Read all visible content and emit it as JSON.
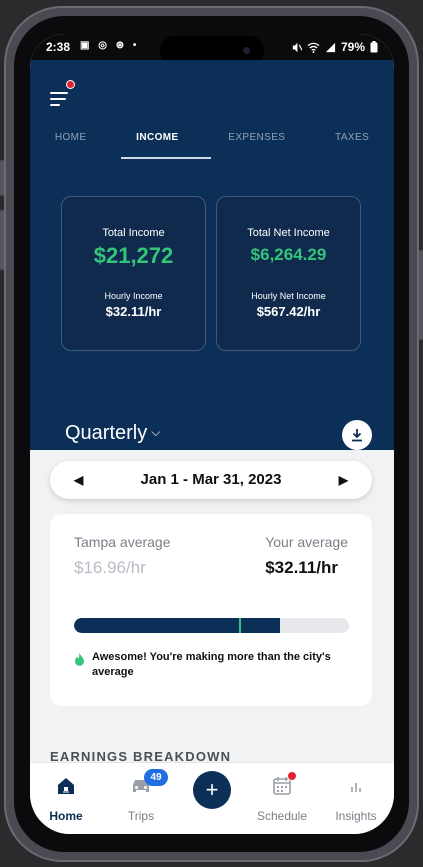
{
  "status_bar": {
    "time": "2:38",
    "battery": "79%"
  },
  "tabs": [
    {
      "label": "HOME"
    },
    {
      "label": "INCOME"
    },
    {
      "label": "EXPENSES"
    },
    {
      "label": "TAXES"
    }
  ],
  "cards": {
    "total_income": {
      "label": "Total Income",
      "value": "$21,272",
      "sub_label": "Hourly Income",
      "sub_value": "$32.11/hr"
    },
    "total_net": {
      "label": "Total Net Income",
      "value": "$6,264.29",
      "sub_label": "Hourly Net Income",
      "sub_value": "$567.42/hr"
    }
  },
  "period": {
    "label": "Quarterly"
  },
  "date_range": {
    "label": "Jan 1 - Mar 31, 2023"
  },
  "average": {
    "city_label": "Tampa average",
    "city_value": "$16.96/hr",
    "your_label": "Your average",
    "your_value": "$32.11/hr",
    "progress_fraction": 0.75,
    "city_marker_fraction": 0.6,
    "message": "Awesome! You're making more than the city's average"
  },
  "section": {
    "title": "EARNINGS BREAKDOWN"
  },
  "bottom_nav": {
    "home": "Home",
    "trips": "Trips",
    "trips_badge": "49",
    "add": "+",
    "schedule": "Schedule",
    "insights": "Insights"
  },
  "colors": {
    "navy": "#0c2f57",
    "green": "#34c47a",
    "badge_blue": "#1f6fe0",
    "alert_red": "#e8202b"
  }
}
